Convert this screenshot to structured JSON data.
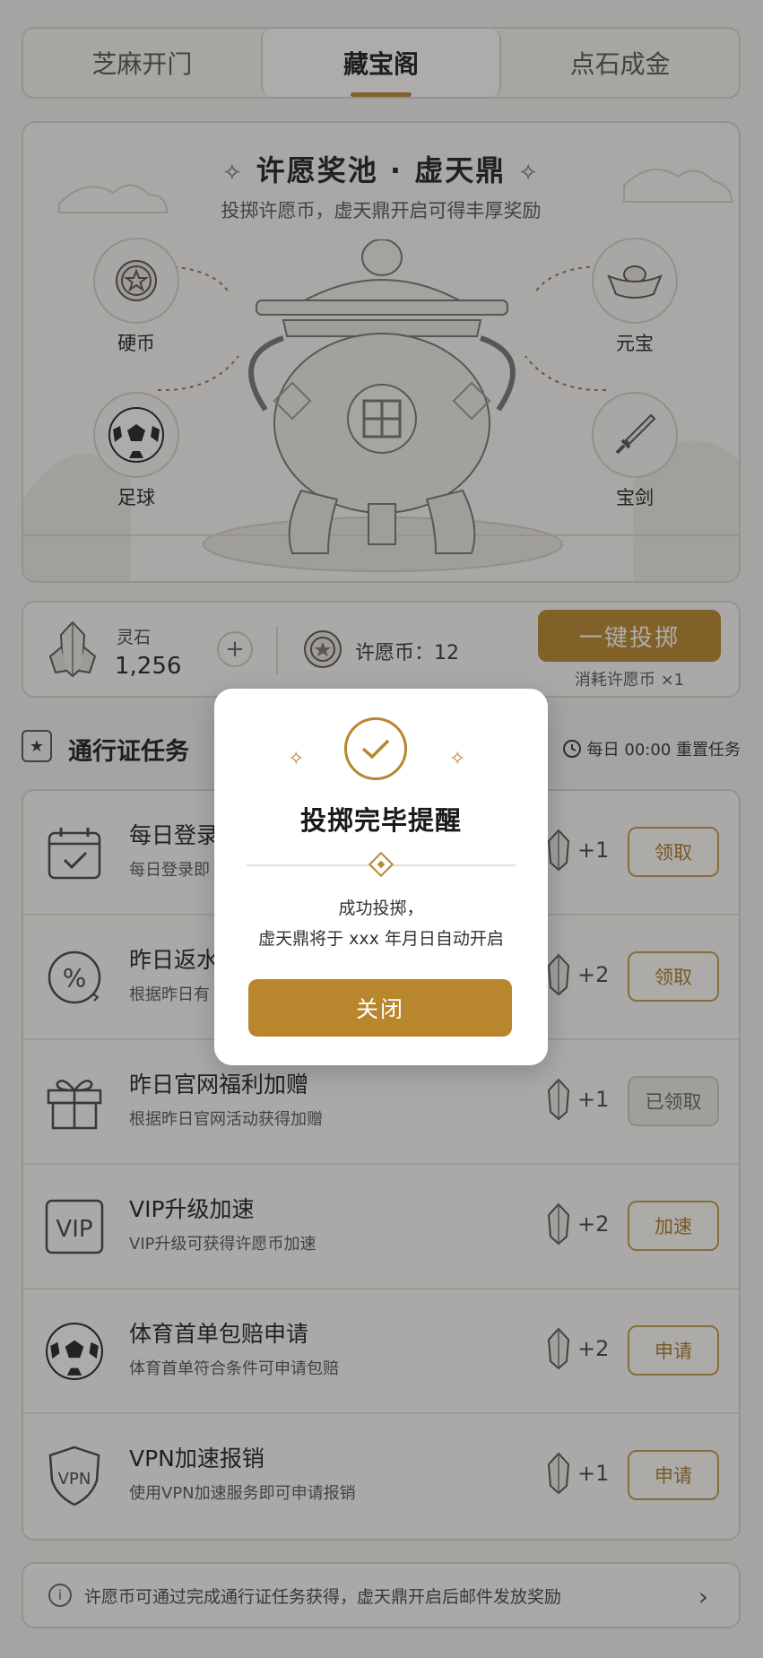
{
  "tabs": [
    {
      "label": "芝麻开门"
    },
    {
      "label": "藏宝阁"
    },
    {
      "label": "点石成金"
    }
  ],
  "hero": {
    "title": "许愿奖池 · 虚天鼎",
    "subtitle": "投掷许愿币，虚天鼎开启可得丰厚奖励",
    "prizes": [
      {
        "label": "硬币",
        "icon": "coin-icon"
      },
      {
        "label": "足球",
        "icon": "soccer-ball-icon"
      },
      {
        "label": "元宝",
        "icon": "gold-ingot-icon"
      },
      {
        "label": "宝剑",
        "icon": "sword-icon"
      }
    ]
  },
  "balance": {
    "stone_label": "灵石",
    "stone_value": "1,256",
    "plus": "+",
    "coin_label": "许愿币：12",
    "throw_button": "一键投掷",
    "throw_cost": "消耗许愿币 ×1"
  },
  "tasks_section": {
    "title": "通行证任务",
    "reset": "每日 00:00 重置任务",
    "items": [
      {
        "title": "每日登录",
        "desc": "每日登录即",
        "reward": "+1",
        "button": "领取",
        "icon": "calendar-check-icon",
        "done": false
      },
      {
        "title": "昨日返水",
        "desc": "根据昨日有",
        "reward": "+2",
        "button": "领取",
        "icon": "percent-icon",
        "done": false
      },
      {
        "title": "昨日官网福利加赠",
        "desc": "根据昨日官网活动获得加赠",
        "reward": "+1",
        "button": "已领取",
        "icon": "gift-icon",
        "done": true
      },
      {
        "title": "VIP升级加速",
        "desc": "VIP升级可获得许愿币加速",
        "reward": "+2",
        "button": "加速",
        "icon": "vip-icon",
        "done": false
      },
      {
        "title": "体育首单包赔申请",
        "desc": "体育首单符合条件可申请包赔",
        "reward": "+2",
        "button": "申请",
        "icon": "soccer-ball-icon",
        "done": false
      },
      {
        "title": "VPN加速报销",
        "desc": "使用VPN加速服务即可申请报销",
        "reward": "+1",
        "button": "申请",
        "icon": "vpn-shield-icon",
        "done": false
      }
    ]
  },
  "footer": {
    "note": "许愿币可通过完成通行证任务获得，虚天鼎开启后邮件发放奖励",
    "chevron": "›"
  },
  "modal": {
    "title": "投掷完毕提醒",
    "message_line1": "成功投掷，",
    "message_line2": "虚天鼎将于 xxx 年月日自动开启",
    "close_button": "关闭"
  },
  "colors": {
    "accent": "#b8862d",
    "overlay": "rgba(40,38,35,0.38)"
  }
}
